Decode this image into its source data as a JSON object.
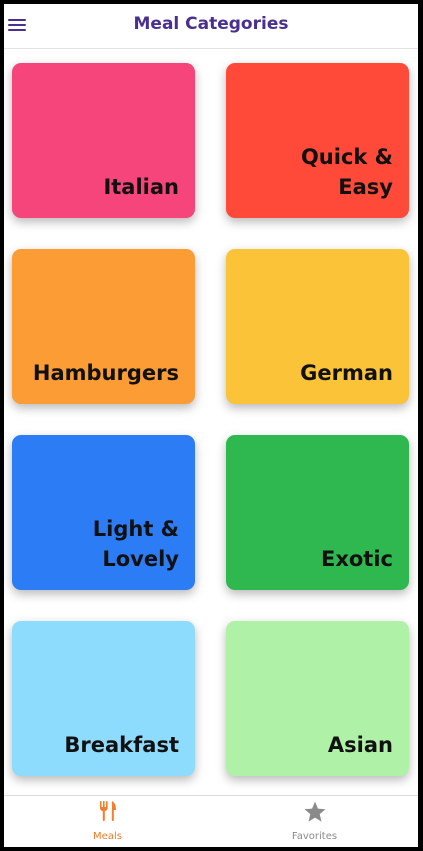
{
  "header": {
    "title": "Meal Categories",
    "menu_icon": "hamburger-menu-icon"
  },
  "categories": [
    {
      "label": "Italian",
      "color": "#f5457a"
    },
    {
      "label": "Quick & Easy",
      "color": "#ff4a3a"
    },
    {
      "label": "Hamburgers",
      "color": "#fb9c35"
    },
    {
      "label": "German",
      "color": "#fbc438"
    },
    {
      "label": "Light & Lovely",
      "color": "#2c7cf6"
    },
    {
      "label": "Exotic",
      "color": "#2fb84f"
    },
    {
      "label": "Breakfast",
      "color": "#8edcfd"
    },
    {
      "label": "Asian",
      "color": "#aff1a6"
    }
  ],
  "tabs": [
    {
      "label": "Meals",
      "icon": "fork-knife-icon",
      "active": true,
      "color": "#f57c28"
    },
    {
      "label": "Favorites",
      "icon": "star-icon",
      "active": false,
      "color": "#8a8a8a"
    }
  ],
  "colors": {
    "accent": "#4a2f8f",
    "active_tab": "#f57c28",
    "inactive_tab": "#8a8a8a"
  }
}
